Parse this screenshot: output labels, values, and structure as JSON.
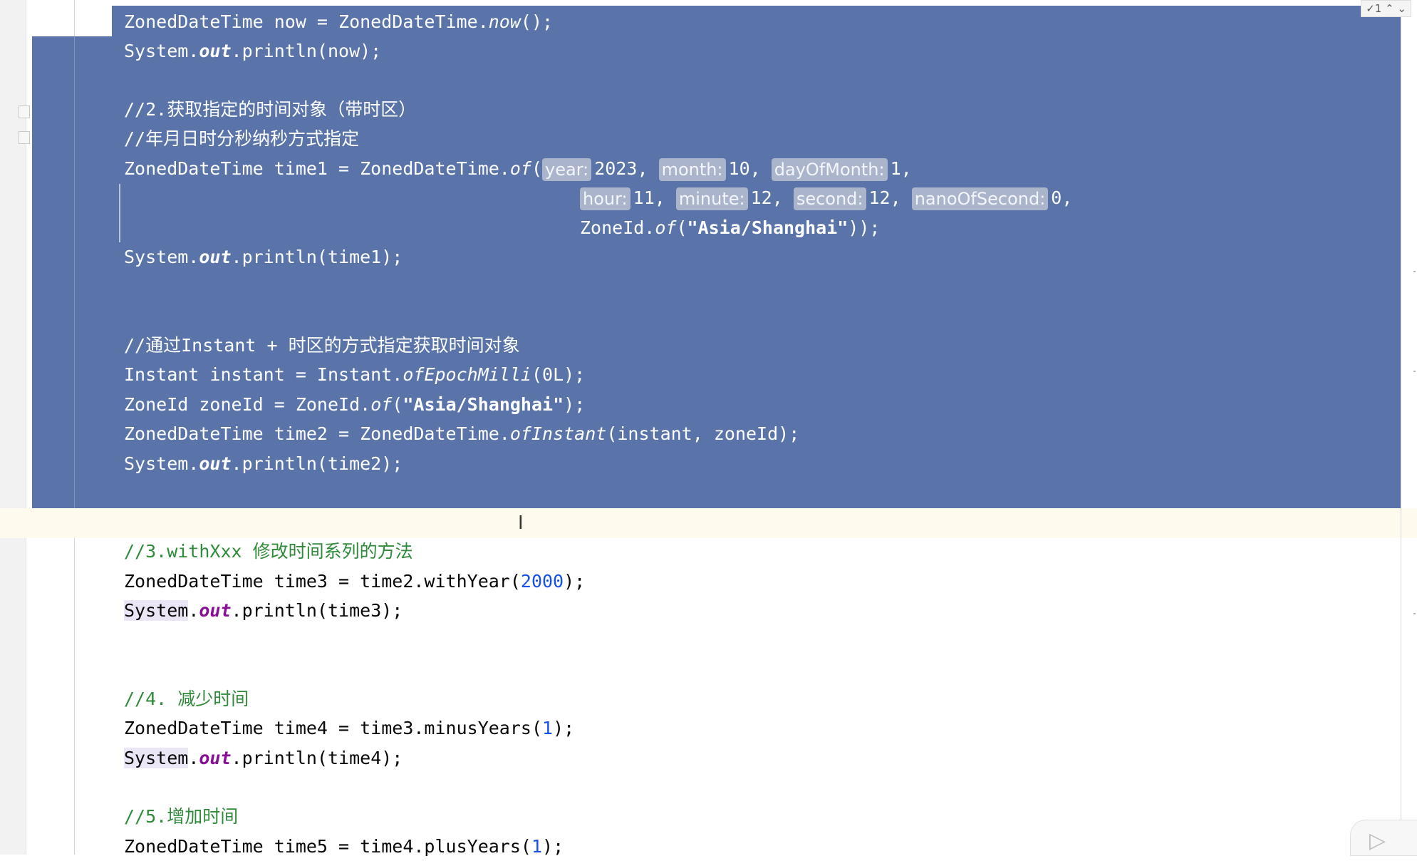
{
  "editor": {
    "status_badge": "✓1  ⌃ ⌄",
    "lines": {
      "l01": [
        "ZonedDateTime now = ZonedDateTime.",
        "now",
        "();"
      ],
      "l02": [
        "System.",
        "out",
        ".println(now);"
      ],
      "l03": "//2.获取指定的时间对象（带时区）",
      "l04": "//年月日时分秒纳秒方式指定",
      "l05": {
        "pre": "ZonedDateTime time1 = ZonedDateTime.",
        "call": "of",
        "open": "(",
        "h_year": "year:",
        "v_year": "2023, ",
        "h_month": "month:",
        "v_month": "10, ",
        "h_day": "dayOfMonth:",
        "v_day": "1,"
      },
      "l06": {
        "h_hour": "hour:",
        "v_hour": "11, ",
        "h_minute": "minute:",
        "v_minute": "12, ",
        "h_second": "second:",
        "v_second": "12, ",
        "h_nano": "nanoOfSecond:",
        "v_nano": "0,"
      },
      "l07": [
        "ZoneId.",
        "of",
        "(",
        "\"Asia/Shanghai\"",
        "));"
      ],
      "l08": [
        "System.",
        "out",
        ".println(time1);"
      ],
      "l09": "//通过Instant + 时区的方式指定获取时间对象",
      "l10": [
        "Instant instant = Instant.",
        "ofEpochMilli",
        "(0L);"
      ],
      "l11": [
        "ZoneId zoneId = ZoneId.",
        "of",
        "(",
        "\"Asia/Shanghai\"",
        ");"
      ],
      "l12": [
        "ZonedDateTime time2 = ZonedDateTime.",
        "ofInstant",
        "(instant, zoneId);"
      ],
      "l13": [
        "System.",
        "out",
        ".println(time2);"
      ],
      "l14": "//3.withXxx 修改时间系列的方法",
      "l15": [
        "ZonedDateTime time3 = time2.withYear(",
        "2000",
        ");"
      ],
      "l16": [
        "System",
        ".",
        "out",
        ".println(time3);"
      ],
      "l17": "//4. 减少时间",
      "l18": [
        "ZonedDateTime time4 = time3.minusYears(",
        "1",
        ");"
      ],
      "l19": [
        "System",
        ".",
        "out",
        ".println(time4);"
      ],
      "l20": "//5.增加时间",
      "l21": [
        "ZonedDateTime time5 = time4.plusYears(",
        "1",
        ");"
      ]
    },
    "cursor_glyph": "I",
    "corner_icon": "play-icon"
  }
}
